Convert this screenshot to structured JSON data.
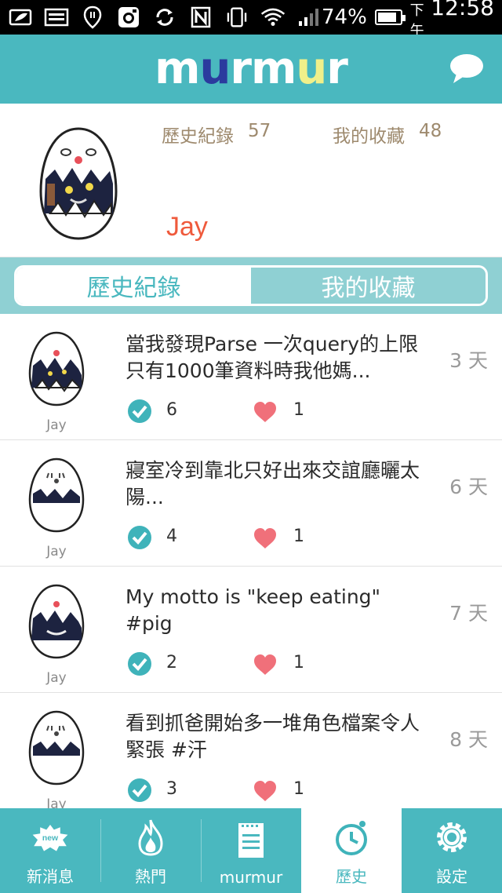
{
  "status_bar": {
    "battery_percent": "74%",
    "ampm": "下午",
    "time": "12:58",
    "icons": [
      "leaf-icon",
      "image-icon",
      "location-icon",
      "instagram-icon",
      "sync-icon",
      "nfc-icon",
      "vibrate-icon",
      "wifi-icon",
      "signal-icon",
      "battery-icon"
    ]
  },
  "app": {
    "logo_letters": [
      "m",
      "u",
      "r",
      "m",
      "u",
      "r"
    ],
    "logo_colors": [
      "#ffffff",
      "#2b3a9e",
      "#ffffff",
      "#ffffff",
      "#f0f08a",
      "#ffffff"
    ],
    "accent": "#4ab8bf"
  },
  "profile": {
    "history_label": "歷史紀錄",
    "history_count": "57",
    "favorites_label": "我的收藏",
    "favorites_count": "48",
    "name": "Jay"
  },
  "segment": {
    "tabs": [
      {
        "label": "歷史紀錄",
        "selected": true
      },
      {
        "label": "我的收藏",
        "selected": false
      }
    ]
  },
  "posts": [
    {
      "user": "Jay",
      "text": "當我發現Parse 一次query的上限只有1000筆資料時我他媽...",
      "time": "3 天",
      "checks": "6",
      "likes": "1"
    },
    {
      "user": "Jay",
      "text": "寢室冷到靠北只好出來交誼廳曬太陽...",
      "time": "6 天",
      "checks": "4",
      "likes": "1"
    },
    {
      "user": "Jay",
      "text": "My motto is \"keep eating\" #pig",
      "time": "7 天",
      "checks": "2",
      "likes": "1"
    },
    {
      "user": "Jay",
      "text": "看到抓爸開始多一堆角色檔案令人緊張 #汗",
      "time": "8 天",
      "checks": "3",
      "likes": "1"
    }
  ],
  "nav": {
    "items": [
      {
        "label": "新消息",
        "icon": "new-badge-icon",
        "badge": "new"
      },
      {
        "label": "熱門",
        "icon": "flame-icon"
      },
      {
        "label": "murmur",
        "icon": "notepad-icon"
      },
      {
        "label": "歷史",
        "icon": "clock-icon",
        "active": true
      },
      {
        "label": "設定",
        "icon": "gear-icon"
      }
    ]
  }
}
